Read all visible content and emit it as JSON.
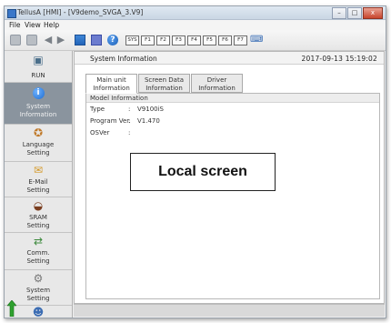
{
  "window": {
    "title": "TellusA [HMI] - [V9demo_SVGA_3.V9]",
    "controls": {
      "minimize": "–",
      "maximize": "□",
      "close": "x"
    }
  },
  "menu": {
    "items": [
      "File",
      "View",
      "Help"
    ]
  },
  "toolbar": {
    "help_glyph": "?",
    "fkeys": [
      "SYS",
      "F1",
      "F2",
      "F3",
      "F4",
      "F5",
      "F6",
      "F7"
    ]
  },
  "sidebar": {
    "items": [
      {
        "label": "RUN",
        "icon": "run-icon"
      },
      {
        "label": "System Information",
        "icon": "info-icon",
        "active": true
      },
      {
        "label": "Language Setting",
        "icon": "language-icon"
      },
      {
        "label": "E-Mail Setting",
        "icon": "email-icon"
      },
      {
        "label": "SRAM Setting",
        "icon": "sram-icon"
      },
      {
        "label": "Comm. Setting",
        "icon": "comm-icon"
      },
      {
        "label": "System Setting",
        "icon": "system-setting-icon"
      },
      {
        "label": "",
        "icon": "user-icon"
      }
    ]
  },
  "content": {
    "section_title": "System Information",
    "datetime": "2017-09-13  15:19:02",
    "tabs": [
      {
        "line1": "Main unit",
        "line2": "Information",
        "active": true
      },
      {
        "line1": "Screen Data",
        "line2": "Information"
      },
      {
        "line1": "Driver",
        "line2": "Information"
      }
    ],
    "group_title": "Model Information",
    "rows": [
      {
        "label": "Type",
        "sep": ":",
        "value": "V9100iS"
      },
      {
        "label": "Program Ver.",
        "sep": ":",
        "value": "V1.470"
      },
      {
        "label": "OSVer",
        "sep": ":",
        "value": ""
      }
    ]
  },
  "overlay_label": "Local screen"
}
